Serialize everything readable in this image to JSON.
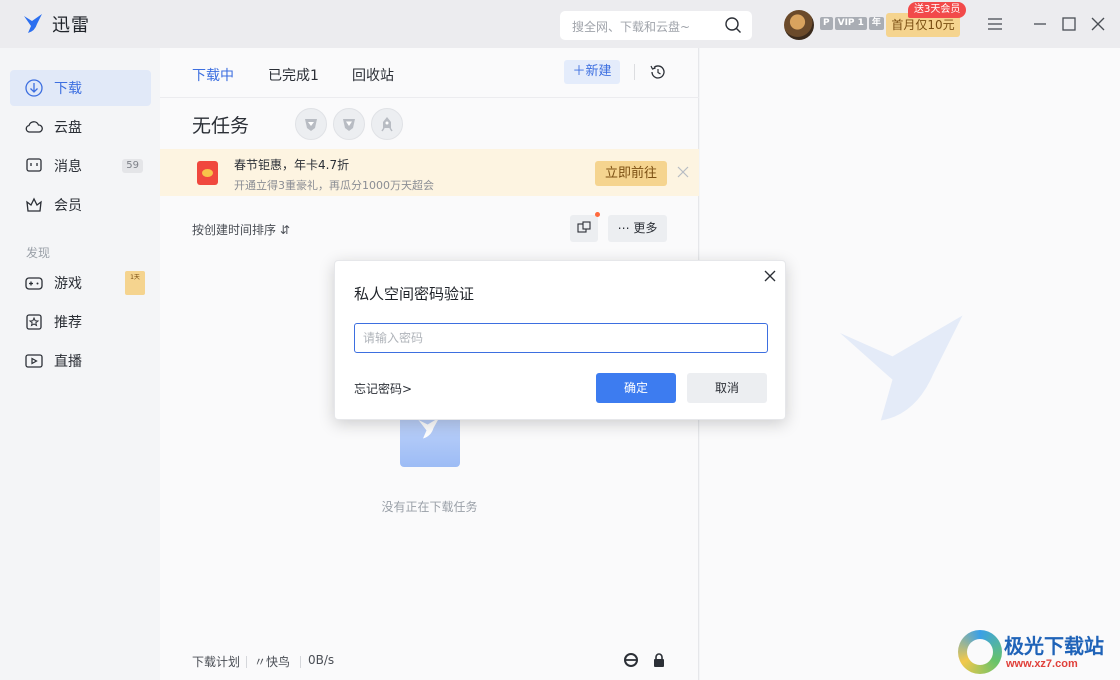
{
  "app": {
    "title": "迅雷"
  },
  "search": {
    "placeholder": "搜全网、下载和云盘~"
  },
  "account": {
    "badge_p": "P",
    "badge_vip": "VIP 1",
    "badge_year": "年",
    "promo_tag": "送3天会员",
    "promo_label": "首月仅10元"
  },
  "sidebar": {
    "items": [
      {
        "label": "下载",
        "icon": "download-icon"
      },
      {
        "label": "云盘",
        "icon": "cloud-icon"
      },
      {
        "label": "消息",
        "icon": "message-icon",
        "count": "59"
      },
      {
        "label": "会员",
        "icon": "crown-icon"
      }
    ],
    "discover_label": "发现",
    "discover_items": [
      {
        "label": "游戏",
        "icon": "gamepad-icon",
        "badge": "1天"
      },
      {
        "label": "推荐",
        "icon": "star-icon"
      },
      {
        "label": "直播",
        "icon": "live-icon"
      }
    ]
  },
  "tabs": [
    {
      "label": "下载中",
      "active": true
    },
    {
      "label": "已完成1"
    },
    {
      "label": "回收站"
    }
  ],
  "toolbar": {
    "new_label": "新建"
  },
  "main": {
    "heading": "无任务",
    "banner": {
      "title": "春节钜惠，年卡4.7折",
      "subtitle": "开通立得3重豪礼，再瓜分1000万天超会",
      "button": "立即前往"
    },
    "sort_label": "按创建时间排序",
    "more_label": "更多",
    "empty_text": "没有正在下载任务"
  },
  "footer": {
    "plan": "下载计划",
    "mode": "快鸟",
    "speed": "0B/s"
  },
  "modal": {
    "title": "私人空间密码验证",
    "input_placeholder": "请输入密码",
    "forgot": "忘记密码>",
    "ok": "确定",
    "cancel": "取消"
  },
  "watermark": {
    "title": "极光下载站",
    "url": "www.xz7.com"
  },
  "colors": {
    "accent": "#3d6fe0",
    "button_primary": "#3d7cf0",
    "promo": "#f5d48f"
  }
}
